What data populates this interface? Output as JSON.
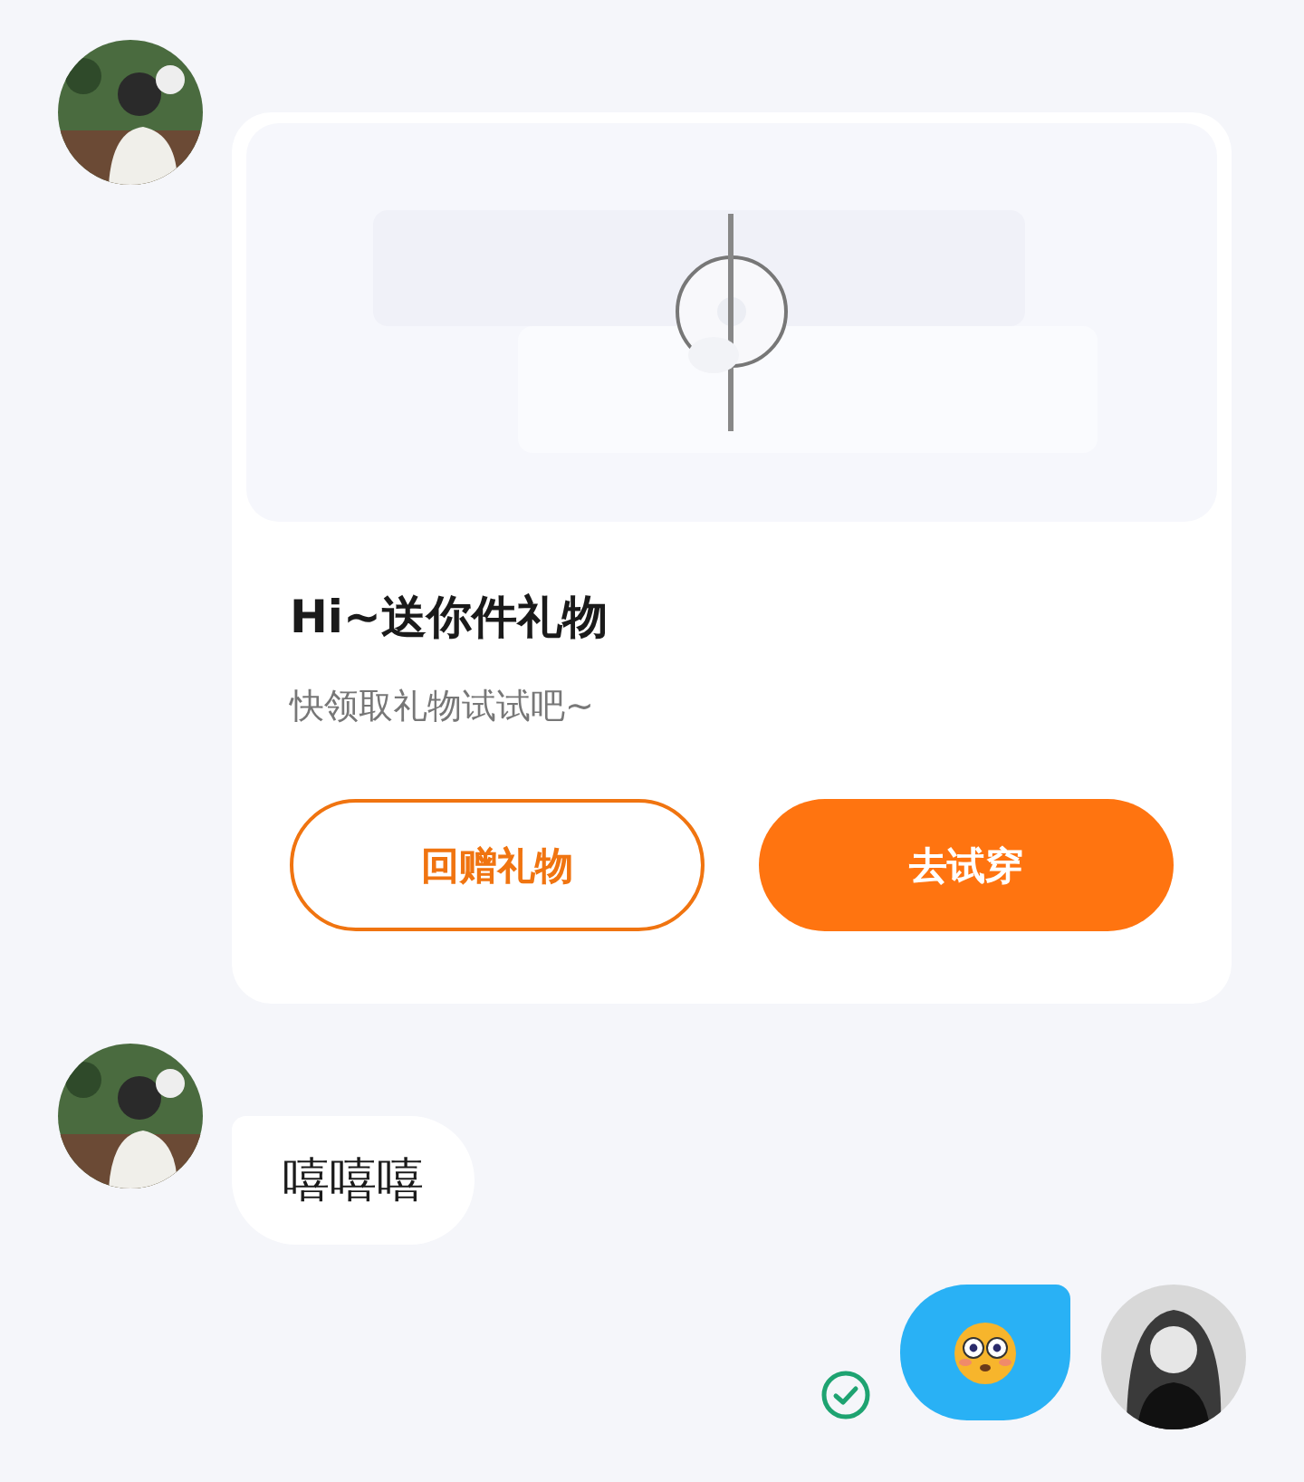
{
  "messages": [
    {
      "kind": "card",
      "outgoing": false,
      "banner": {
        "kind": "picture"
      },
      "title": "Hi~送你件礼物",
      "subtitle": "快领取礼物试试吧~",
      "buttons": [
        {
          "label": "回赠礼物",
          "kind": "outline"
        },
        {
          "label": "去试穿",
          "kind": "filled"
        }
      ]
    },
    {
      "kind": "text",
      "outgoing": false,
      "text": "嘻嘻嘻"
    },
    {
      "kind": "emoji",
      "outgoing": true,
      "delivered": true
    }
  ]
}
